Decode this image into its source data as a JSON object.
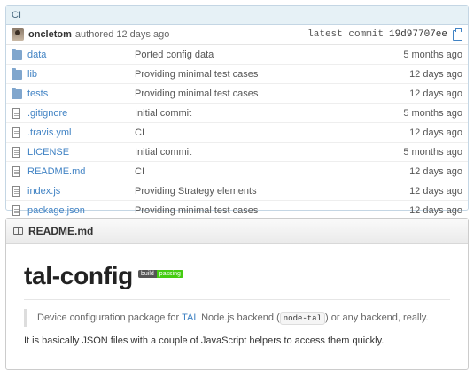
{
  "commit": {
    "message": "CI",
    "author": "oncletom",
    "authored": "authored 12 days ago",
    "latest_label": "latest commit",
    "sha": "19d97707ee"
  },
  "files": [
    {
      "type": "folder",
      "icon": "folder-icon",
      "name": "data",
      "message": "Ported config data",
      "age": "5 months ago"
    },
    {
      "type": "folder",
      "icon": "folder-icon",
      "name": "lib",
      "message": "Providing minimal test cases",
      "age": "12 days ago"
    },
    {
      "type": "folder",
      "icon": "folder-icon",
      "name": "tests",
      "message": "Providing minimal test cases",
      "age": "12 days ago"
    },
    {
      "type": "file",
      "icon": "file-icon",
      "name": ".gitignore",
      "message": "Initial commit",
      "age": "5 months ago"
    },
    {
      "type": "file",
      "icon": "file-icon",
      "name": ".travis.yml",
      "message": "CI",
      "age": "12 days ago"
    },
    {
      "type": "file",
      "icon": "file-icon",
      "name": "LICENSE",
      "message": "Initial commit",
      "age": "5 months ago"
    },
    {
      "type": "file",
      "icon": "file-icon",
      "name": "README.md",
      "message": "CI",
      "age": "12 days ago"
    },
    {
      "type": "file",
      "icon": "file-icon",
      "name": "index.js",
      "message": "Providing Strategy elements",
      "age": "12 days ago"
    },
    {
      "type": "file",
      "icon": "file-icon",
      "name": "package.json",
      "message": "Providing minimal test cases",
      "age": "12 days ago"
    }
  ],
  "readme": {
    "header": "README.md",
    "title": "tal-config",
    "badge_left": "build",
    "badge_right": "passing",
    "badge_right_color": "#44cc11",
    "quote_pre": "Device configuration package for",
    "quote_link": "TAL",
    "quote_mid": "Node.js backend (",
    "quote_code": "node-tal",
    "quote_post": ") or any backend, really.",
    "paragraph": "It is basically JSON files with a couple of JavaScript helpers to access them quickly."
  },
  "colors": {
    "link": "#4183c4",
    "commit_bar": "#e6f1f6",
    "folder": "#80a6cd"
  }
}
